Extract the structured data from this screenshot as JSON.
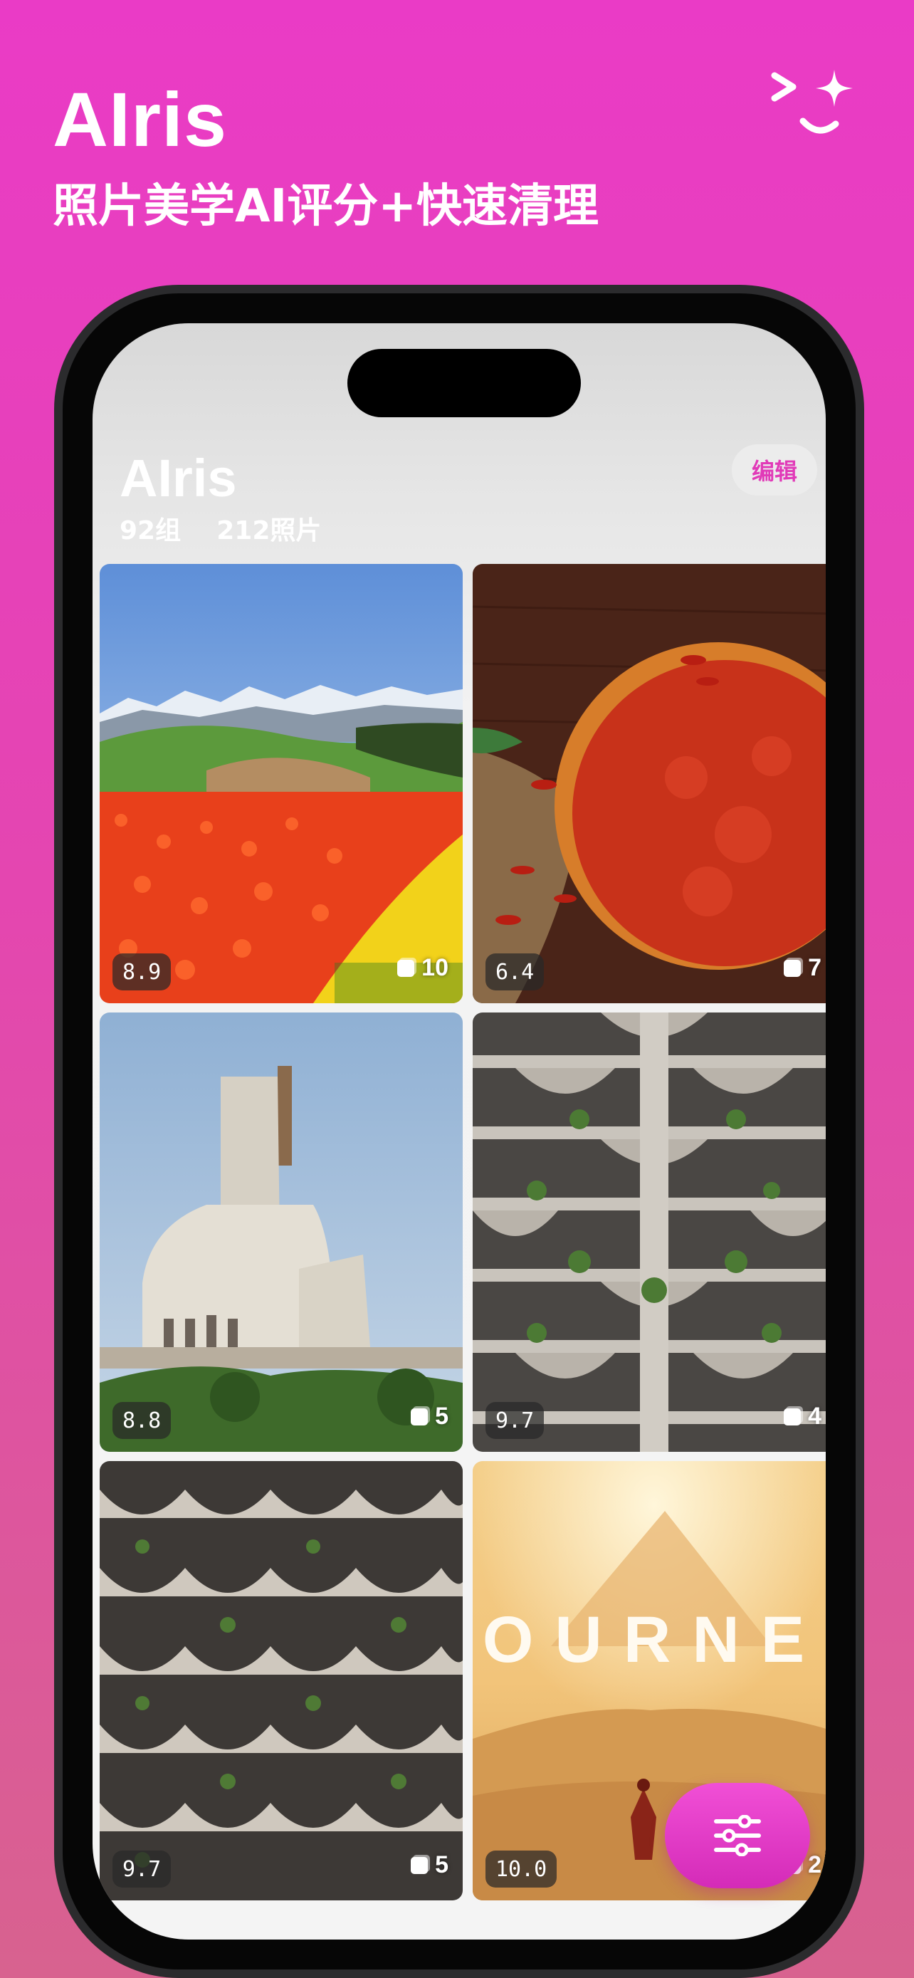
{
  "hero": {
    "title": "AIris",
    "subtitle": "照片美学AI评分+快速清理",
    "logo_icon": "smile-sparkle-icon"
  },
  "app": {
    "title": "AIris",
    "groups": "92组",
    "photos": "212照片",
    "edit_label": "编辑"
  },
  "photos": [
    {
      "score": "8.9",
      "count": "10",
      "subject": "tulip field with mountains"
    },
    {
      "score": "6.4",
      "count": "7",
      "subject": "red chili powder on wood"
    },
    {
      "score": "8.8",
      "count": "5",
      "subject": "modernist building with tower"
    },
    {
      "score": "9.7",
      "count": "4",
      "subject": "brutalist balconies with plants"
    },
    {
      "score": "9.7",
      "count": "5",
      "subject": "curved concrete facade"
    },
    {
      "score": "10.0",
      "count": "2",
      "subject": "desert game poster"
    }
  ],
  "poster_text": "OURNE",
  "fab_icon": "sliders-icon",
  "colors": {
    "accent": "#e13ab8",
    "background_top": "#ea3bc6",
    "background_bottom": "#d8628f"
  }
}
